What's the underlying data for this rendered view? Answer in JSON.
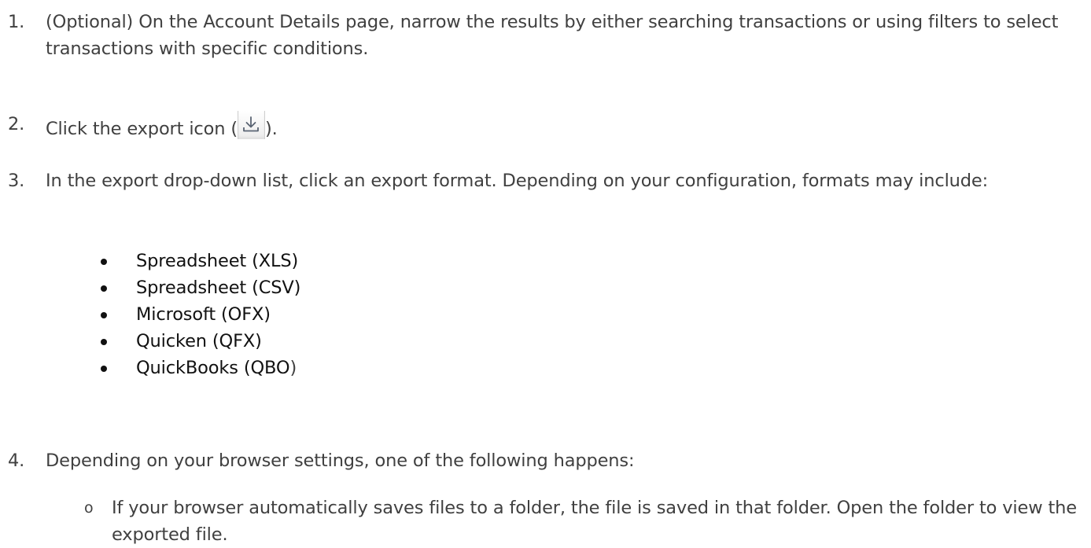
{
  "steps": [
    {
      "number": "1.",
      "text": "(Optional) On the Account Details page, narrow the results by either searching transactions or using filters to select transactions with specific conditions."
    },
    {
      "number": "2.",
      "text_before": "Click the export icon (",
      "text_after": ")."
    },
    {
      "number": "3.",
      "text": "In the export drop-down list, click an export format. Depending on your configuration, formats may include:"
    },
    {
      "number": "4.",
      "text": "Depending on your browser settings, one of the following happens:"
    }
  ],
  "formats": [
    {
      "label": "Spreadsheet (XLS)"
    },
    {
      "label": "Spreadsheet (CSV)"
    },
    {
      "label": "Microsoft (OFX)"
    },
    {
      "label": "Quicken (QFX)"
    },
    {
      "label": "QuickBooks (QBO",
      "suffix": ")"
    }
  ],
  "sub_items": [
    {
      "marker": "o",
      "text": "If your browser automatically saves files to a folder, the file is saved in that folder. Open the folder to view the exported file."
    }
  ],
  "icons": {
    "export": "download-icon"
  },
  "colors": {
    "body_text": "#404040",
    "bullet_text": "#111111",
    "icon_stroke": "#5a6473"
  }
}
